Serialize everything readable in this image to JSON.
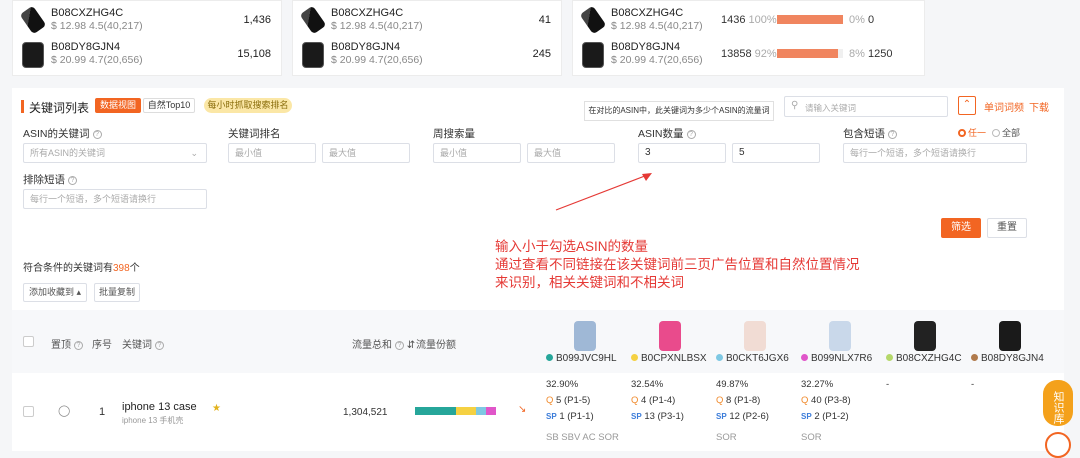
{
  "top_cards": [
    {
      "rows": [
        {
          "asin": "B08CXZHG4C",
          "sub": "$ 12.98  4.5(40,217)",
          "num": "1,436",
          "img": "white"
        },
        {
          "asin": "B08DY8GJN4",
          "sub": "$ 20.99  4.7(20,656)",
          "num": "15,108",
          "img": "black"
        }
      ]
    },
    {
      "rows": [
        {
          "asin": "B08CXZHG4C",
          "sub": "$ 12.98  4.5(40,217)",
          "num": "41",
          "img": "white"
        },
        {
          "asin": "B08DY8GJN4",
          "sub": "$ 20.99  4.7(20,656)",
          "num": "245",
          "img": "black"
        }
      ]
    },
    {
      "rows": [
        {
          "asin": "B08CXZHG4C",
          "sub": "$ 12.98  4.5(40,217)",
          "num": "1436",
          "pct": "100%",
          "bar": 1.0,
          "rest": "0%",
          "rest_num": "0",
          "img": "white"
        },
        {
          "asin": "B08DY8GJN4",
          "sub": "$ 20.99  4.7(20,656)",
          "num": "13858",
          "pct": "92%",
          "bar": 0.92,
          "rest": "8%",
          "rest_num": "1250",
          "img": "black"
        }
      ]
    }
  ],
  "section": {
    "title": "关键词列表",
    "tab_active": "数据视图",
    "tab_other": "自然Top10",
    "tab_hourly": "每小时抓取搜索排名",
    "tooltip": "在对比的ASIN中，此关键词为多少个ASIN的流量词",
    "search_placeholder": "请输入关键词",
    "link_root": "单词词频",
    "link_download": "下载"
  },
  "filters": {
    "asin_kw_label": "ASIN的关键词",
    "asin_kw_value": "所有ASIN的关键词",
    "rank_label": "关键词排名",
    "min_ph": "最小值",
    "max_ph": "最大值",
    "weekly_label": "周搜索量",
    "asin_count_label": "ASIN数量",
    "asin_min": "3",
    "asin_max": "5",
    "include_label": "包含短语",
    "radio_any": "任一",
    "radio_all": "全部",
    "include_ph": "每行一个短语，多个短语请换行",
    "exclude_label": "排除短语",
    "exclude_ph": "每行一个短语，多个短语请换行",
    "filter_btn": "筛选",
    "reset_btn": "重置"
  },
  "annotation": {
    "line1": "输入小于勾选ASIN的数量",
    "line2": "通过查看不同链接在该关键词前三页广告位置和自然位置情况",
    "line3": "来识别，相关关键词和不相关词"
  },
  "results": {
    "prefix": "符合条件的关键词有",
    "count": "398",
    "suffix": "个",
    "add_fav": "添加收藏到",
    "batch_copy": "批量复制"
  },
  "table": {
    "headers": {
      "pin": "置顶",
      "index": "序号",
      "keyword": "关键词",
      "traffic": "流量总和",
      "share": "流量份额"
    },
    "asins": [
      {
        "asin": "B099JVC9HL",
        "color": "#26a69a",
        "img": "#9fb8d6"
      },
      {
        "asin": "B0CPXNLBSX",
        "color": "#f5d142",
        "img": "#e94b8c"
      },
      {
        "asin": "B0CKT6JGX6",
        "color": "#7ec8e3",
        "img": "#f1dcd4"
      },
      {
        "asin": "B099NLX7R6",
        "color": "#e056c9",
        "img": "#c9d8ea"
      },
      {
        "asin": "B08CXZHG4C",
        "color": "#b5d86a",
        "img": "#222222"
      },
      {
        "asin": "B08DY8GJN4",
        "color": "#b07a4c",
        "img": "#1a1a1a"
      }
    ],
    "row": {
      "index": "1",
      "keyword": "iphone 13 case",
      "keyword_cn": "iphone 13 手机壳",
      "traffic": "1,304,521",
      "share": [
        0.41,
        0.2,
        0.1,
        0.1
      ],
      "cells": [
        {
          "pct": "32.90%",
          "q": "5 (P1-5)",
          "sp": "1 (P1-1)"
        },
        {
          "pct": "32.54%",
          "q": "4 (P1-4)",
          "sp": "13 (P3-1)"
        },
        {
          "pct": "49.87%",
          "q": "8 (P1-8)",
          "sp": "12 (P2-6)"
        },
        {
          "pct": "32.27%",
          "q": "40 (P3-8)",
          "sp": "2 (P1-2)"
        },
        {
          "pct": "-"
        },
        {
          "pct": "-"
        }
      ],
      "footer": [
        "SB SBV AC SOR",
        "",
        "SOR",
        "SOR"
      ]
    }
  },
  "float_btn": "知识库"
}
